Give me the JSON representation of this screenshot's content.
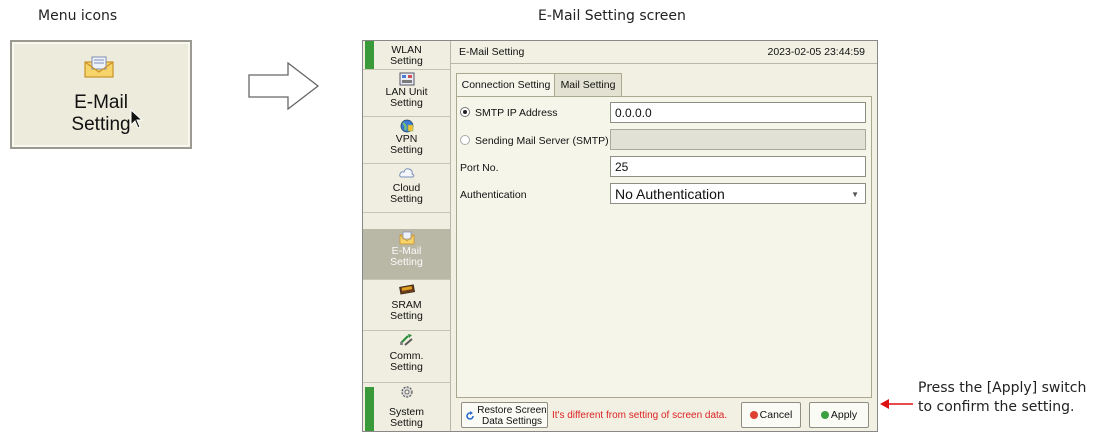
{
  "captions": {
    "menu_icons": "Menu icons",
    "screen_title": "E-Mail Setting screen"
  },
  "menu_icon": {
    "line1": "E-Mail",
    "line2": "Setting",
    "icon": "envelope-icon"
  },
  "sidebar": {
    "items": [
      {
        "label1": "WLAN",
        "label2": "Setting",
        "icon": "wlan-icon"
      },
      {
        "label1": "LAN Unit",
        "label2": "Setting",
        "icon": "lan-unit-icon"
      },
      {
        "label1": "VPN",
        "label2": "Setting",
        "icon": "vpn-globe-icon"
      },
      {
        "label1": "Cloud",
        "label2": "Setting",
        "icon": "cloud-icon"
      },
      {
        "label1": "E-Mail",
        "label2": "Setting",
        "icon": "envelope-icon",
        "active": true
      },
      {
        "label1": "SRAM",
        "label2": "Setting",
        "icon": "sram-chip-icon"
      },
      {
        "label1": "Comm.",
        "label2": "Setting",
        "icon": "comm-icon"
      },
      {
        "label1": "System",
        "label2": "Setting",
        "icon": "gear-icon"
      }
    ]
  },
  "window": {
    "title": "E-Mail Setting",
    "datetime": "2023-02-05  23:44:59"
  },
  "tabs": [
    {
      "label": "Connection Setting",
      "selected": true
    },
    {
      "label": "Mail Setting",
      "selected": false
    }
  ],
  "form": {
    "smtp_ip_label": "SMTP IP Address",
    "smtp_ip_value": "0.0.0.0",
    "sending_server_label": "Sending Mail Server (SMTP)",
    "sending_server_value": "",
    "port_label": "Port No.",
    "port_value": "25",
    "auth_label": "Authentication",
    "auth_value": "No Authentication"
  },
  "footer": {
    "restore_line1": "Restore Screen",
    "restore_line2": "Data Settings",
    "warning": "It's different from setting of screen data.",
    "cancel": "Cancel",
    "apply": "Apply"
  },
  "annotation": {
    "line1": "Press the [Apply] switch",
    "line2": "to confirm the setting."
  },
  "colors": {
    "accent_green": "#3a9a3a",
    "warning_red": "#dd2222",
    "arrow_red": "#dd1111"
  }
}
